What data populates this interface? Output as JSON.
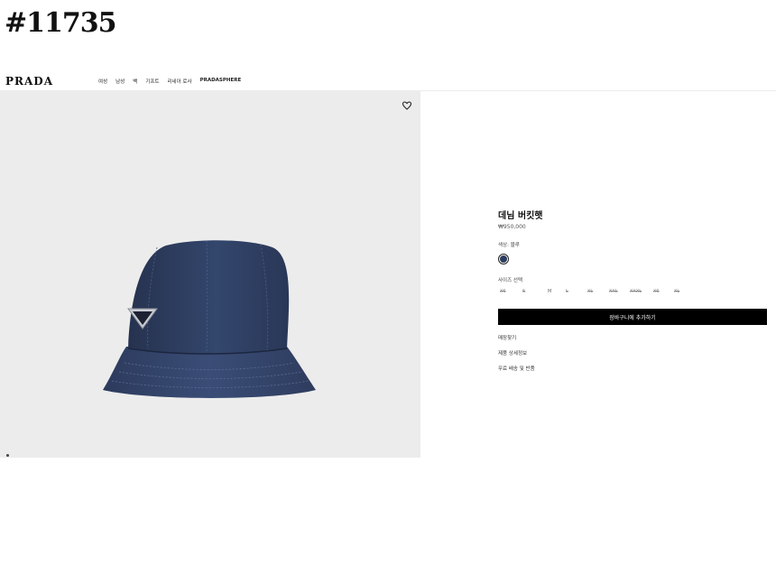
{
  "listing_id": "#11735",
  "header": {
    "logo": "PRADA",
    "nav": [
      "여성",
      "남성",
      "백",
      "기프트",
      "리네아 로사",
      "PRADASPHERE"
    ]
  },
  "gallery": {
    "wishlist_icon": "heart-icon"
  },
  "product": {
    "title": "데님 버킷햇",
    "price": "₩950,000",
    "color_label": "색상: 블루",
    "color_swatch": "#2b3d5e",
    "size_label": "사이즈 선택",
    "sizes": [
      "XS",
      "S",
      "M",
      "L",
      "XL",
      "XXL",
      "XXXL",
      "XS",
      "XL"
    ],
    "add_to_cart": "장바구니에 추가하기",
    "links": [
      "매장찾기",
      "제품 상세정보",
      "무료 배송 및 반품"
    ]
  }
}
